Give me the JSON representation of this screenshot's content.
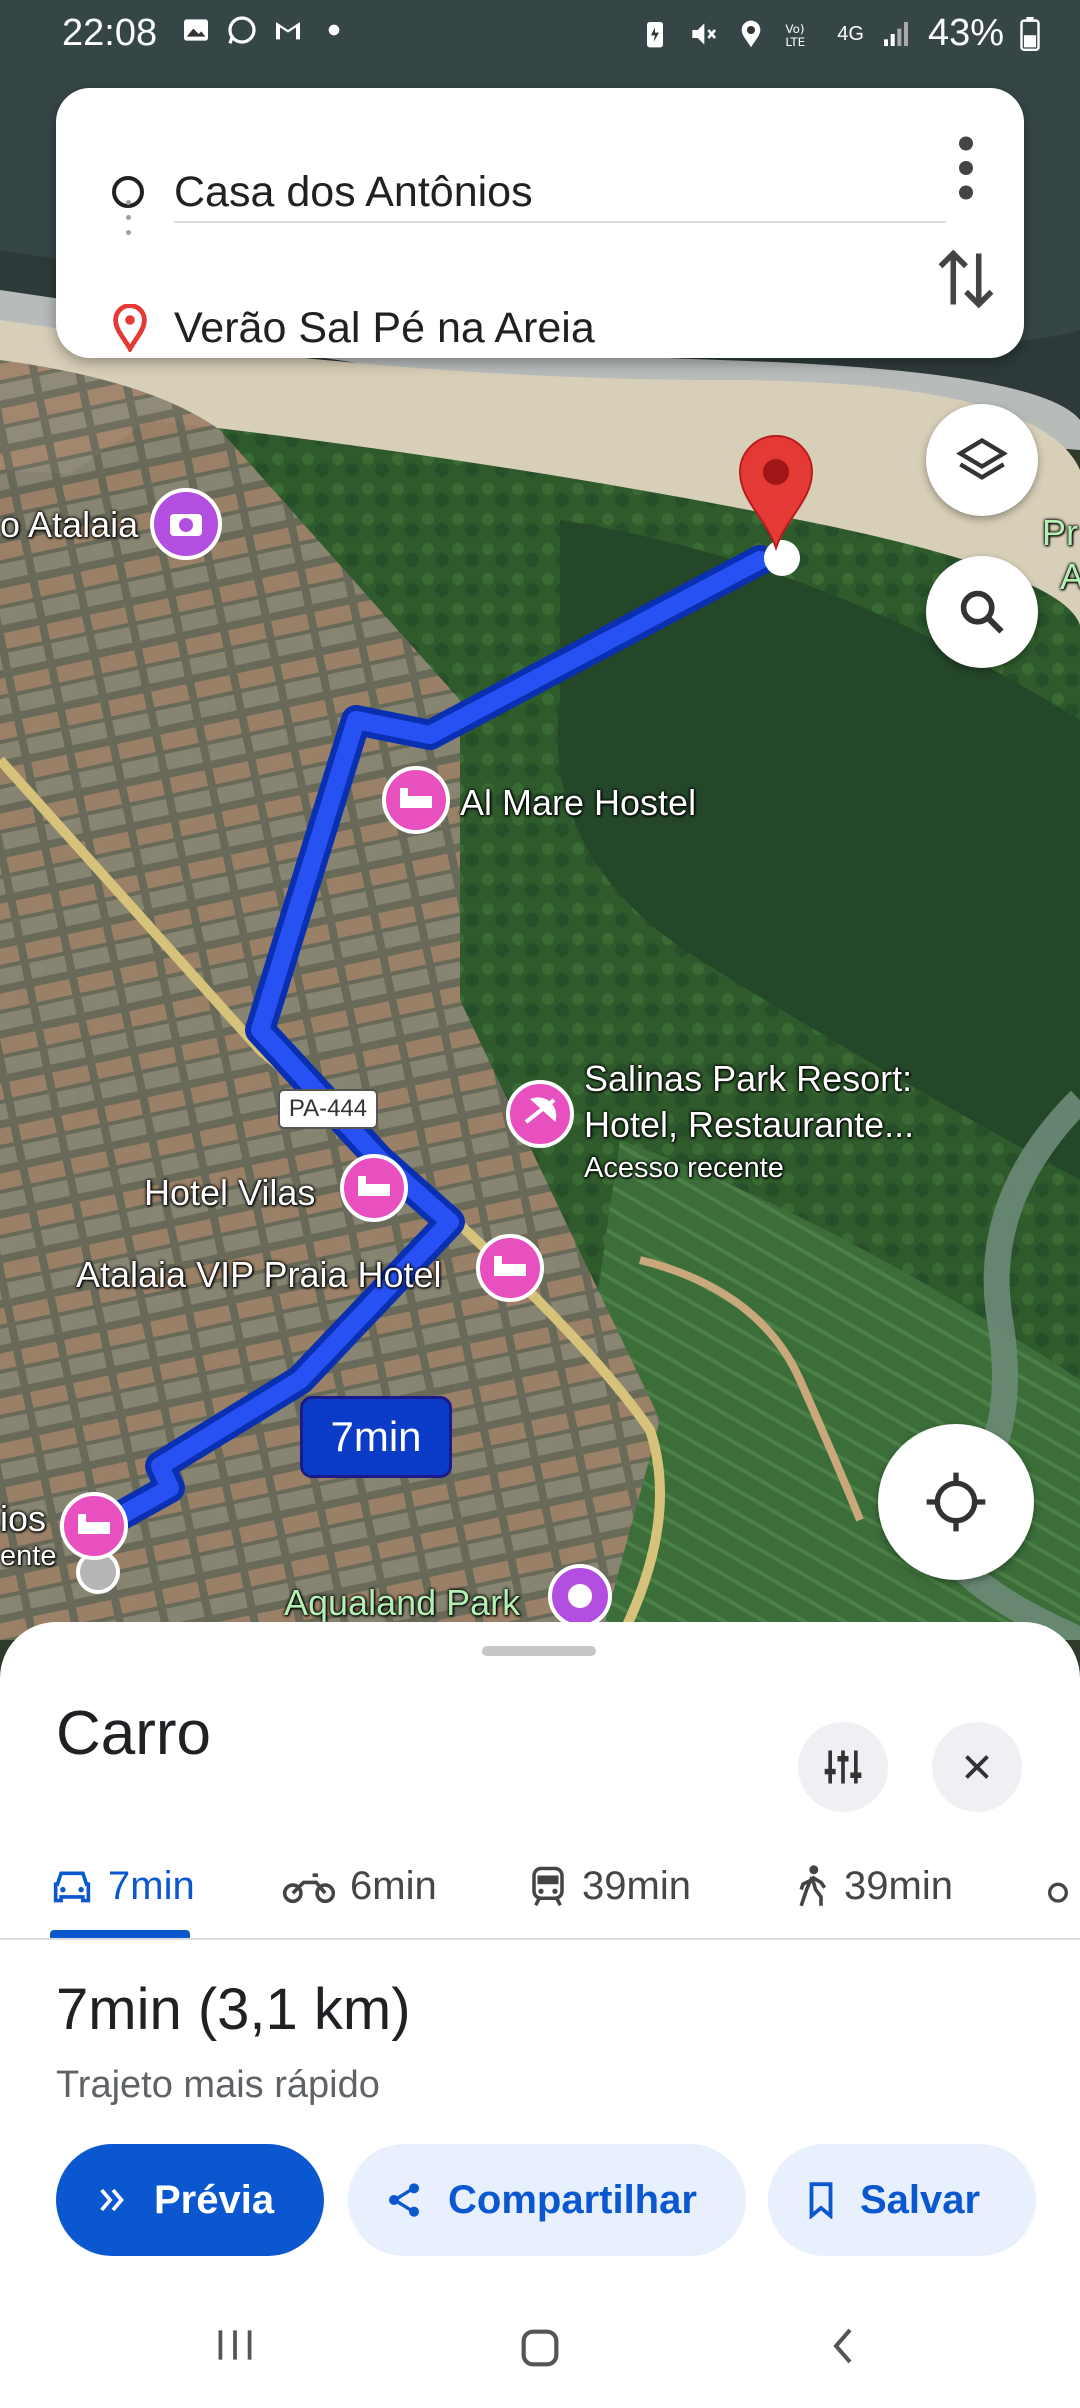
{
  "status_bar": {
    "time": "22:08",
    "battery": "43%",
    "network": "4G",
    "left_icons": [
      "gallery-icon",
      "whatsapp-icon",
      "gmail-icon",
      "dot-icon"
    ],
    "right_icons": [
      "battery-saver-icon",
      "mute-icon",
      "location-icon",
      "volte-icon",
      "signal-icon",
      "battery-icon"
    ]
  },
  "route": {
    "origin": "Casa dos Antônios",
    "destination": "Verão Sal Pé na Areia"
  },
  "map": {
    "labels": {
      "atalaia": "o Atalaia",
      "al_mare": "Al Mare Hostel",
      "salinas_line1": "Salinas Park Resort:",
      "salinas_line2": "Hotel, Restaurante...",
      "salinas_sub": "Acesso recente",
      "hotel_vilas": "Hotel Vilas",
      "atalaia_vip": "Atalaia VIP Praia Hotel",
      "aqualand": "Aqualand Park",
      "left_cut_1": "ios",
      "left_cut_2": "ente",
      "right_cut_1": "Pr",
      "right_cut_2": "A"
    },
    "road_shield": "PA-444",
    "route_time_chip": "7min"
  },
  "sheet": {
    "title": "Carro",
    "modes": [
      {
        "icon": "car-icon",
        "label": "7min",
        "active": true
      },
      {
        "icon": "motorcycle-icon",
        "label": "6min",
        "active": false
      },
      {
        "icon": "transit-icon",
        "label": "39min",
        "active": false
      },
      {
        "icon": "walk-icon",
        "label": "39min",
        "active": false
      }
    ],
    "summary": "7min (3,1 km)",
    "subtitle": "Trajeto mais rápido",
    "actions": {
      "preview": "Prévia",
      "share": "Compartilhar",
      "save": "Salvar"
    }
  },
  "colors": {
    "accent": "#0b57d0",
    "route": "#1a3fe0",
    "poi_pink": "#e84fbf",
    "dest_pin": "#e53935"
  }
}
